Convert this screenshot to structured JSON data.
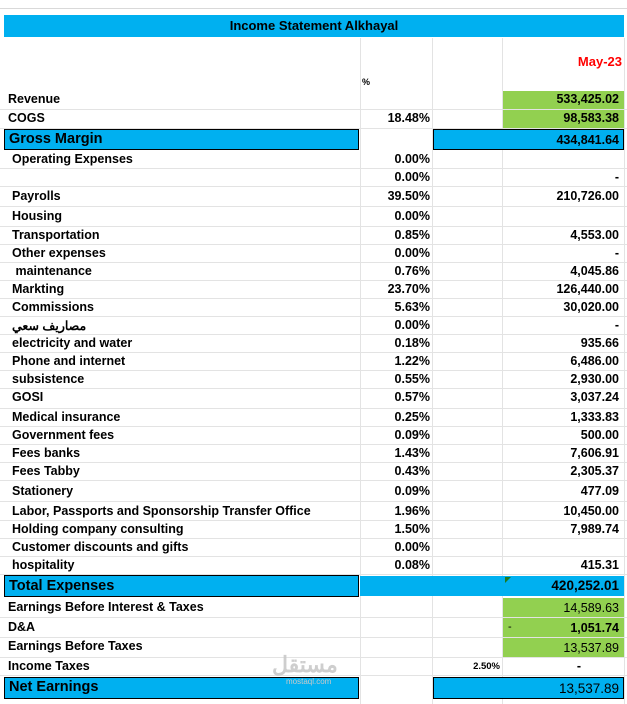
{
  "header": {
    "title": "Income Statement Alkhayal",
    "month": "May-23",
    "pct_symbol": "%"
  },
  "rows": [
    {
      "label": "Revenue",
      "pct": "",
      "value": "533,425.02"
    },
    {
      "label": "COGS",
      "pct": "18.48%",
      "value": "98,583.38"
    },
    {
      "label": "Operating Expenses",
      "pct": "0.00%",
      "value": ""
    },
    {
      "label": "",
      "pct": "0.00%",
      "value": "-"
    },
    {
      "label": "Payrolls",
      "pct": "39.50%",
      "value": "210,726.00"
    },
    {
      "label": "Housing",
      "pct": "0.00%",
      "value": ""
    },
    {
      "label": "Transportation",
      "pct": "0.85%",
      "value": "4,553.00"
    },
    {
      "label": "Other expenses",
      "pct": "0.00%",
      "value": "-"
    },
    {
      "label": " maintenance",
      "pct": "0.76%",
      "value": "4,045.86"
    },
    {
      "label": "Markting",
      "pct": "23.70%",
      "value": "126,440.00"
    },
    {
      "label": "Commissions",
      "pct": "5.63%",
      "value": "30,020.00"
    },
    {
      "label": "مصاريف سعي",
      "pct": "0.00%",
      "value": "-"
    },
    {
      "label": "electricity and water",
      "pct": "0.18%",
      "value": "935.66"
    },
    {
      "label": "Phone and internet",
      "pct": "1.22%",
      "value": "6,486.00"
    },
    {
      "label": "subsistence",
      "pct": "0.55%",
      "value": "2,930.00"
    },
    {
      "label": "GOSI",
      "pct": "0.57%",
      "value": "3,037.24"
    },
    {
      "label": "Medical insurance",
      "pct": "0.25%",
      "value": "1,333.83"
    },
    {
      "label": "Government fees",
      "pct": "0.09%",
      "value": "500.00"
    },
    {
      "label": "Fees banks",
      "pct": "1.43%",
      "value": "7,606.91"
    },
    {
      "label": "Fees Tabby",
      "pct": "0.43%",
      "value": "2,305.37"
    },
    {
      "label": "Stationery",
      "pct": "0.09%",
      "value": "477.09"
    },
    {
      "label": "Labor, Passports and Sponsorship Transfer Office",
      "pct": "1.96%",
      "value": "10,450.00"
    },
    {
      "label": "Holding company consulting",
      "pct": "1.50%",
      "value": "7,989.74"
    },
    {
      "label": "Customer discounts and gifts",
      "pct": "0.00%",
      "value": ""
    },
    {
      "label": "hospitality",
      "pct": "0.08%",
      "value": "415.31"
    }
  ],
  "gross_margin": {
    "label": "Gross Margin",
    "value": "434,841.64"
  },
  "total_expenses": {
    "label": "Total Expenses",
    "value": "420,252.01"
  },
  "ebit": {
    "label": "Earnings Before Interest & Taxes",
    "value": "14,589.63"
  },
  "da": {
    "label": "D&A",
    "prefix": "-",
    "value": "1,051.74"
  },
  "ebt": {
    "label": "Earnings Before Taxes",
    "value": "13,537.89"
  },
  "income_taxes": {
    "label": "Income Taxes",
    "pct": "2.50%",
    "value": "-"
  },
  "net_earnings": {
    "label": "Net Earnings",
    "value": "13,537.89"
  },
  "watermark": {
    "text": "مستقل",
    "sub": "mostaql.com"
  }
}
